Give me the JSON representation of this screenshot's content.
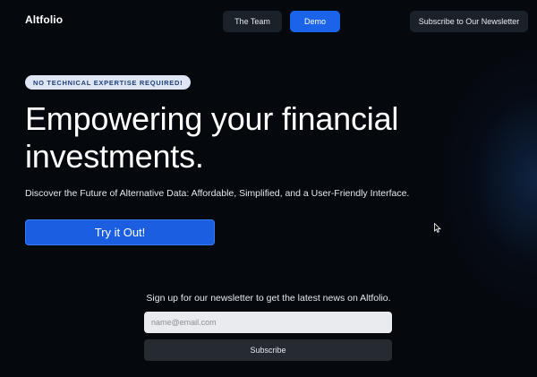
{
  "header": {
    "logo": "Altfolio",
    "nav": {
      "team_label": "The Team",
      "demo_label": "Demo",
      "subscribe_label": "Subscribe to Our Newsletter"
    }
  },
  "hero": {
    "badge": "NO TECHNICAL EXPERTISE REQUIRED!",
    "headline": "Empowering your financial investments.",
    "subheadline": "Discover the Future of Alternative Data: Affordable, Simplified, and a User-Friendly Interface.",
    "cta_label": "Try it Out!"
  },
  "newsletter": {
    "text": "Sign up for our newsletter to get the latest news on Altfolio.",
    "email_placeholder": "name@email.com",
    "email_value": "",
    "button_label": "Subscribe"
  },
  "colors": {
    "accent": "#1b63e8",
    "background": "#05080d",
    "nav_button": "#1b2129"
  },
  "icons": {
    "cursor": "mouse-pointer-icon"
  }
}
